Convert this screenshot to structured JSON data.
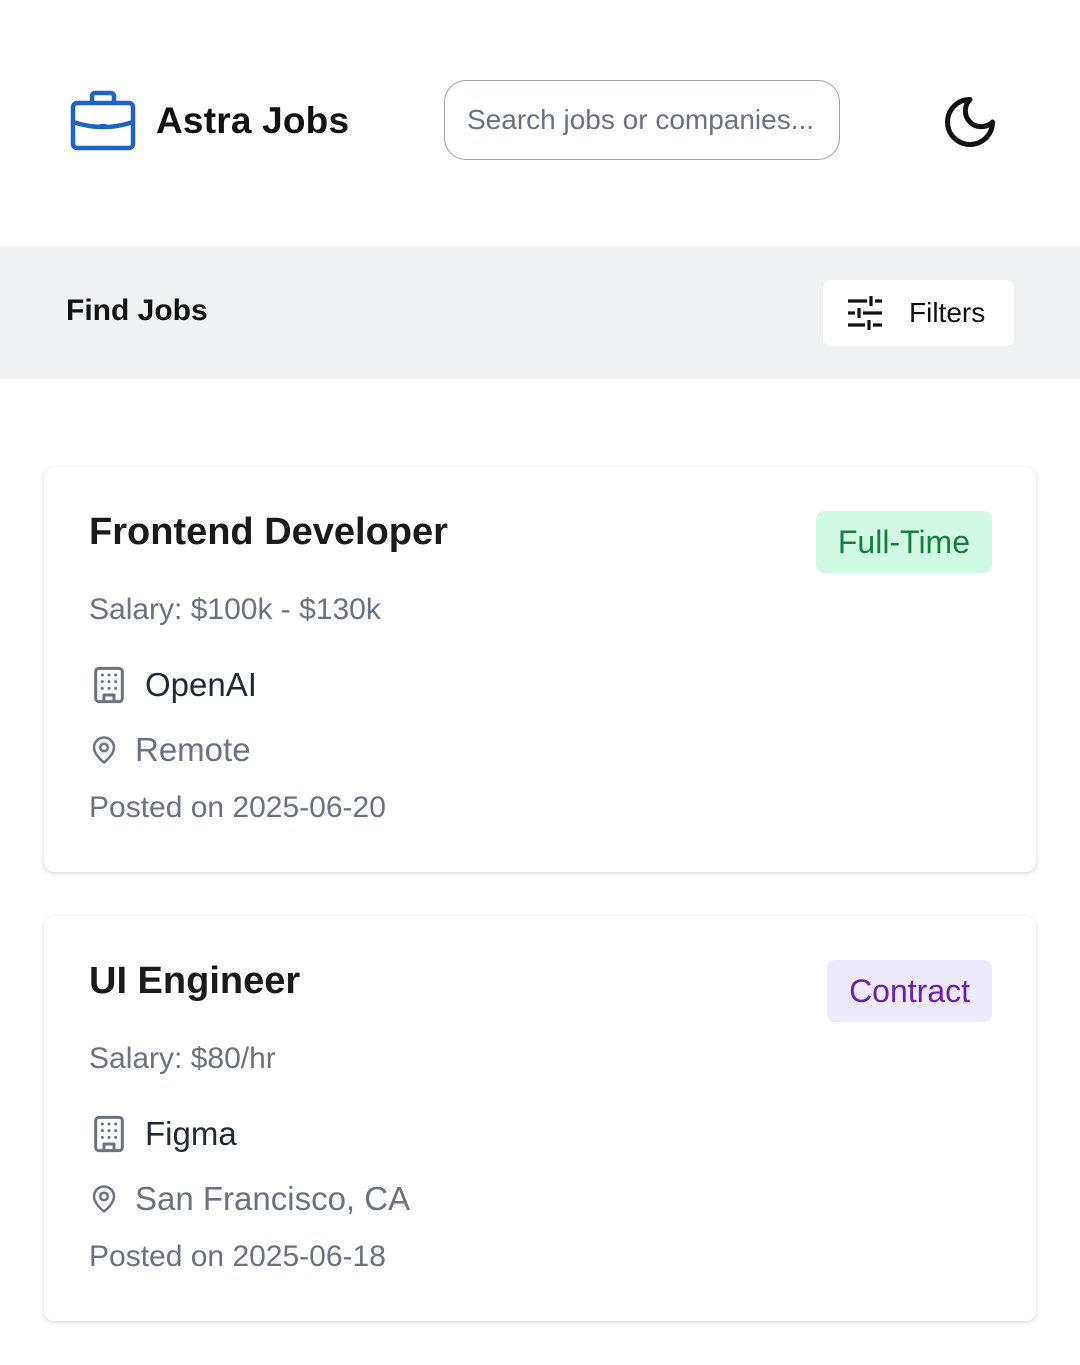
{
  "header": {
    "brand_name": "Astra Jobs",
    "logo_icon": "briefcase-icon",
    "brand_color": "#1d64c3",
    "search": {
      "placeholder": "Search jobs or companies...",
      "value": ""
    },
    "theme_toggle_icon": "moon-icon"
  },
  "toolbar": {
    "title": "Find Jobs",
    "filters_label": "Filters",
    "filters_icon": "sliders-icon"
  },
  "jobs": [
    {
      "title": "Frontend Developer",
      "type": "Full-Time",
      "type_color": "#15803d",
      "type_background": "#d1fae5",
      "salary": "Salary: $100k - $130k",
      "company": "OpenAI",
      "company_icon": "building-icon",
      "location": "Remote",
      "location_icon": "map-pin-icon",
      "posted": "Posted on 2025-06-20"
    },
    {
      "title": "UI Engineer",
      "type": "Contract",
      "type_color": "#6b21a8",
      "type_background": "#ede9fe",
      "salary": "Salary: $80/hr",
      "company": "Figma",
      "company_icon": "building-icon",
      "location": "San Francisco, CA",
      "location_icon": "map-pin-icon",
      "posted": "Posted on 2025-06-18"
    }
  ]
}
